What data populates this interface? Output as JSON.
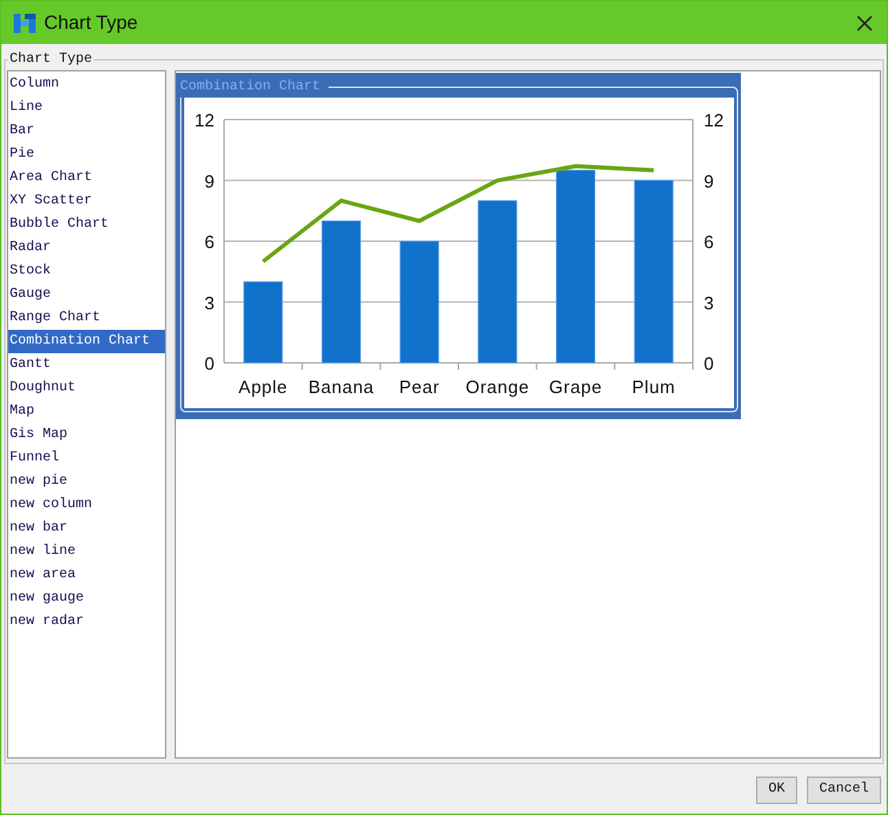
{
  "window": {
    "title": "Chart Type"
  },
  "group": {
    "label": "Chart Type"
  },
  "chart_types": [
    {
      "label": "Column",
      "selected": false
    },
    {
      "label": "Line",
      "selected": false
    },
    {
      "label": "Bar",
      "selected": false
    },
    {
      "label": "Pie",
      "selected": false
    },
    {
      "label": "Area Chart",
      "selected": false
    },
    {
      "label": "XY Scatter",
      "selected": false
    },
    {
      "label": "Bubble Chart",
      "selected": false
    },
    {
      "label": "Radar",
      "selected": false
    },
    {
      "label": "Stock",
      "selected": false
    },
    {
      "label": "Gauge",
      "selected": false
    },
    {
      "label": "Range Chart",
      "selected": false
    },
    {
      "label": "Combination Chart",
      "selected": true
    },
    {
      "label": "Gantt",
      "selected": false
    },
    {
      "label": "Doughnut",
      "selected": false
    },
    {
      "label": "Map",
      "selected": false
    },
    {
      "label": "Gis Map",
      "selected": false
    },
    {
      "label": "Funnel",
      "selected": false
    },
    {
      "label": "new pie",
      "selected": false
    },
    {
      "label": "new column",
      "selected": false
    },
    {
      "label": "new bar",
      "selected": false
    },
    {
      "label": "new line",
      "selected": false
    },
    {
      "label": "new area",
      "selected": false
    },
    {
      "label": "new gauge",
      "selected": false
    },
    {
      "label": "new radar",
      "selected": false
    }
  ],
  "preview": {
    "title": "Combination Chart",
    "chart_data": {
      "type": "bar",
      "categories": [
        "Apple",
        "Banana",
        "Pear",
        "Orange",
        "Grape",
        "Plum"
      ],
      "ylim": [
        0,
        12
      ],
      "yticks": [
        0,
        3,
        6,
        9,
        12
      ],
      "grid": true,
      "series": [
        {
          "color": "#1172cc",
          "values": [
            4,
            7,
            6,
            8,
            9.5,
            9
          ]
        },
        {
          "type": "line",
          "color": "#6aa514",
          "values": [
            5,
            8,
            7,
            9,
            9.7,
            9.5
          ]
        }
      ]
    },
    "right_axis_ticks": [
      "12",
      "9",
      "6",
      "3",
      "0"
    ]
  },
  "buttons": [
    {
      "label": "OK"
    },
    {
      "label": "Cancel"
    }
  ]
}
